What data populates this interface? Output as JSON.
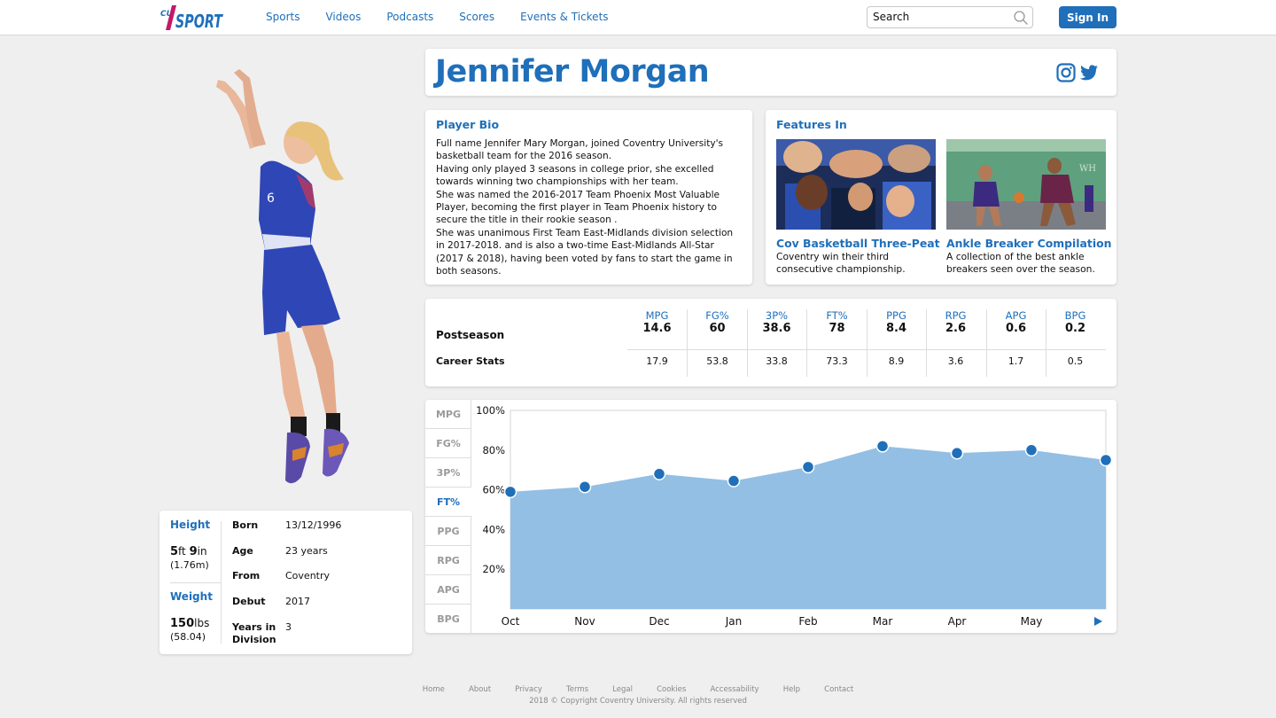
{
  "brand": {
    "logo_prefix": "CU",
    "logo_text": "SPORT",
    "accent": "#1f6fba",
    "logo_magenta": "#c2186b"
  },
  "nav": {
    "items": [
      "Sports",
      "Videos",
      "Podcasts",
      "Scores",
      "Events & Tickets"
    ]
  },
  "search": {
    "placeholder": "Search"
  },
  "auth": {
    "signin_label": "Sign In"
  },
  "player": {
    "name": "Jennifer Morgan",
    "jersey": "6",
    "height_label": "Height",
    "height_ft": "5",
    "height_ft_unit": "ft",
    "height_in": "9",
    "height_in_unit": "in",
    "height_metric": "(1.76m)",
    "weight_label": "Weight",
    "weight_value": "150",
    "weight_unit": "lbs",
    "weight_metric": "(58.04)",
    "details": [
      {
        "key": "Born",
        "value": "13/12/1996"
      },
      {
        "key": "Age",
        "value": "23 years"
      },
      {
        "key": "From",
        "value": "Coventry"
      },
      {
        "key": "Debut",
        "value": "2017"
      },
      {
        "key": "Years in Division",
        "value": "3"
      }
    ]
  },
  "social": [
    "instagram-icon",
    "twitter-icon"
  ],
  "bio": {
    "title": "Player Bio",
    "text": "Full name Jennifer Mary Morgan, joined Coventry University's basketball team for the 2016 season.\nHaving only played 3 seasons in college prior, she excelled towards winning two championships with her team.\nShe was named the 2016-2017 Team Phoenix Most Valuable Player, becoming the first player in Team Phoenix history to secure the title in their rookie season .\nShe was unanimous First Team East-Midlands division selection in 2017-2018. and is also a two-time  East-Midlands All-Star (2017 & 2018), having been voted by fans to start the game in both seasons."
  },
  "features": {
    "title": "Features In",
    "items": [
      {
        "title": "Cov Basketball Three-Peat",
        "desc": "Coventry win their third consecutive championship."
      },
      {
        "title": "Ankle Breaker Compilation",
        "desc": "A collection of the best ankle breakers seen over the season."
      }
    ]
  },
  "stats": {
    "postseason_label": "Postseason",
    "career_label": "Career Stats",
    "columns": [
      {
        "name": "MPG",
        "postseason": "14.6",
        "career": "17.9"
      },
      {
        "name": "FG%",
        "postseason": "60",
        "career": "53.8"
      },
      {
        "name": "3P%",
        "postseason": "38.6",
        "career": "33.8"
      },
      {
        "name": "FT%",
        "postseason": "78",
        "career": "73.3"
      },
      {
        "name": "PPG",
        "postseason": "8.4",
        "career": "8.9"
      },
      {
        "name": "RPG",
        "postseason": "2.6",
        "career": "3.6"
      },
      {
        "name": "APG",
        "postseason": "0.6",
        "career": "1.7"
      },
      {
        "name": "BPG",
        "postseason": "0.2",
        "career": "0.5"
      }
    ]
  },
  "chart_tabs": {
    "items": [
      "MPG",
      "FG%",
      "3P%",
      "FT%",
      "PPG",
      "RPG",
      "APG",
      "BPG"
    ],
    "active": "FT%"
  },
  "chart_data": {
    "type": "area",
    "x": [
      "Oct",
      "Nov",
      "Dec",
      "Jan",
      "Feb",
      "Mar",
      "Apr",
      "May",
      ""
    ],
    "series": [
      {
        "values": [
          59,
          61.5,
          68,
          64.5,
          71.5,
          82,
          78.5,
          80,
          75
        ]
      }
    ],
    "ylim": [
      0,
      100
    ],
    "yticks": [
      "20%",
      "40%",
      "60%",
      "80%",
      "100%"
    ],
    "ytick_values": [
      20,
      40,
      60,
      80,
      100
    ],
    "fill_color": "#93bfe4",
    "point_color": "#1f6fba"
  },
  "footer": {
    "links": [
      "Home",
      "About",
      "Privacy",
      "Terms",
      "Legal",
      "Cookies",
      "Accessability",
      "Help",
      "Contact"
    ],
    "copyright": "2018 © Copyright Coventry University. All rights reserved"
  }
}
